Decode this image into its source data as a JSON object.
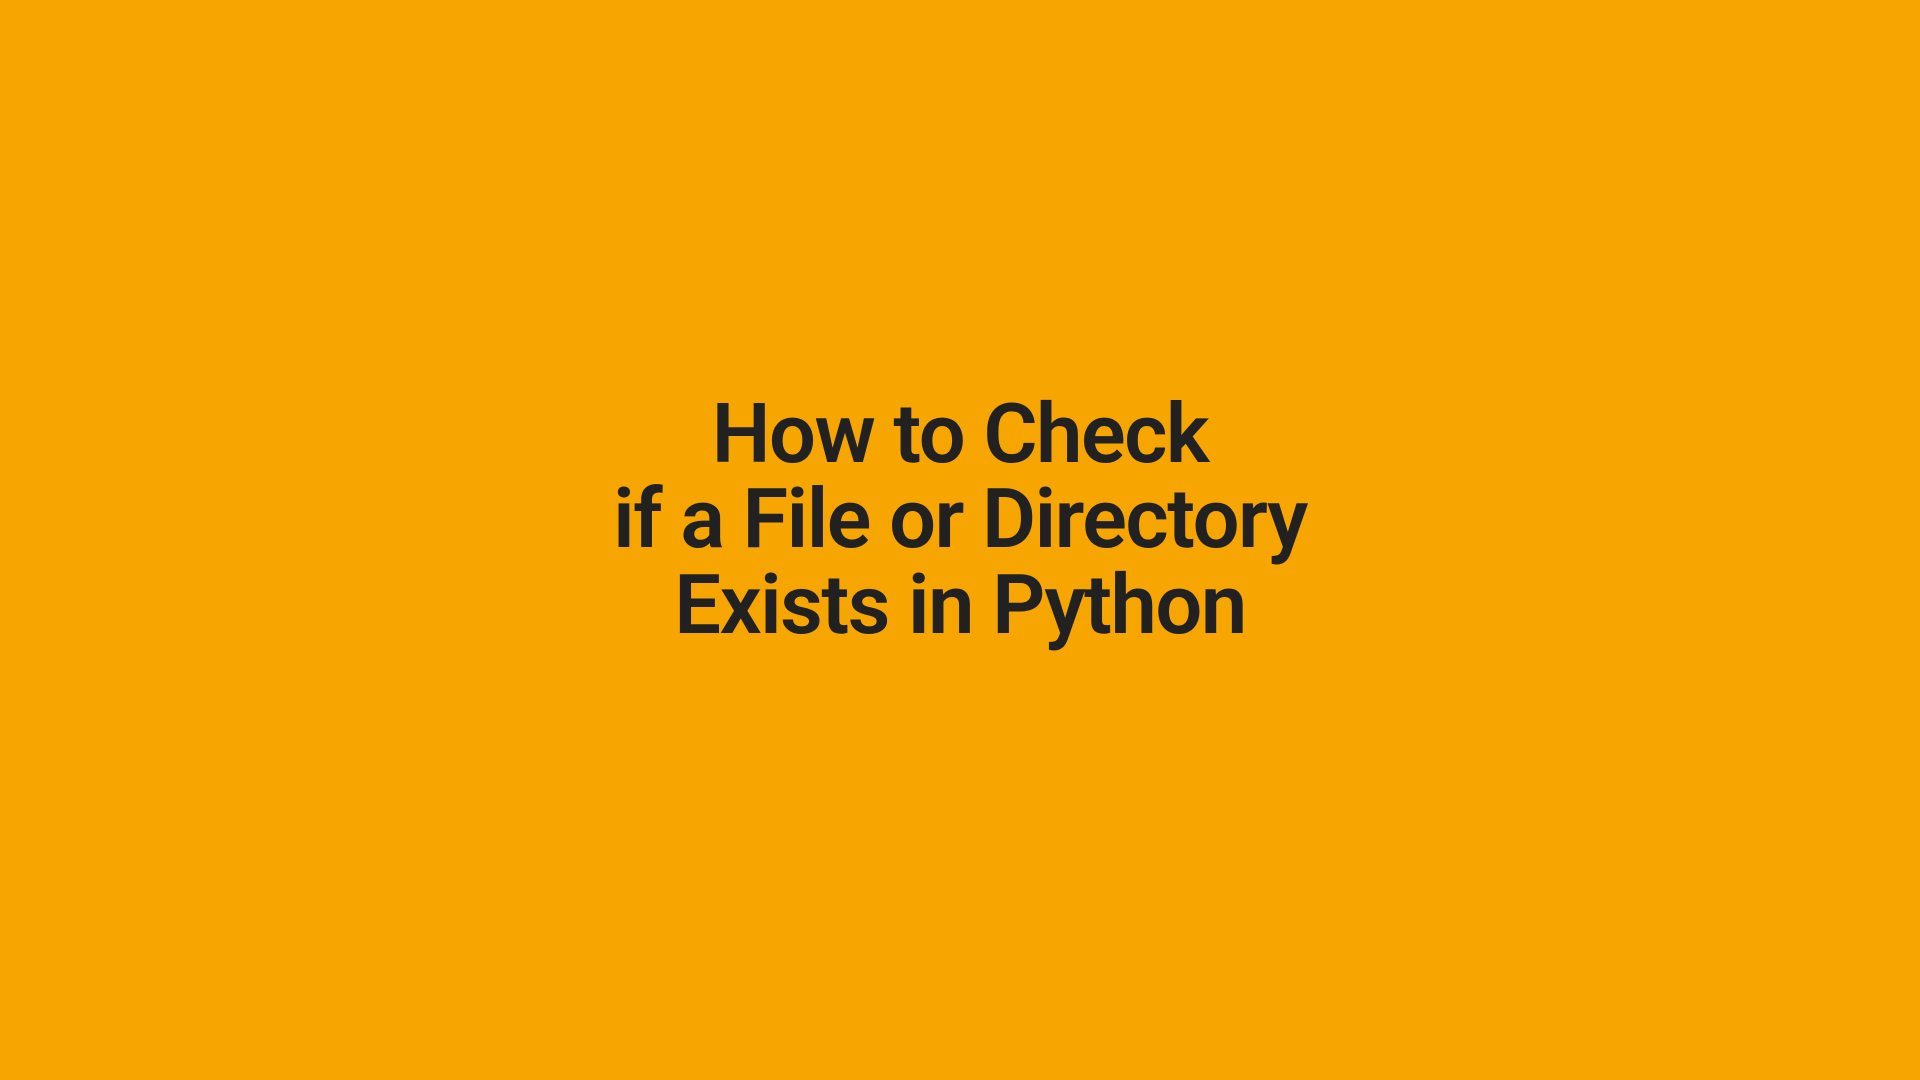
{
  "heading": {
    "line1": "How to Check",
    "line2": "if a File or Directory",
    "line3": "Exists in Python"
  },
  "colors": {
    "background": "#f7a500",
    "text": "#212121"
  }
}
